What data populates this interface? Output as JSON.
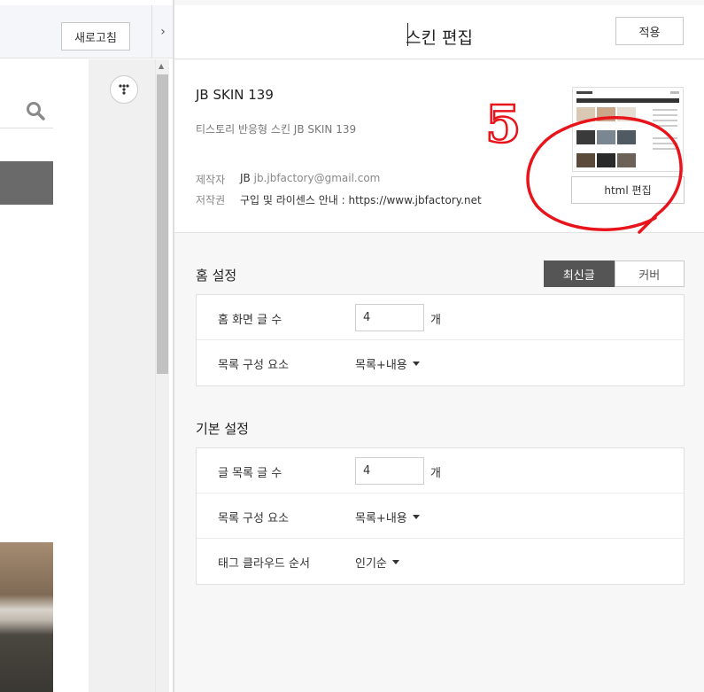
{
  "left": {
    "refresh_label": "새로고침",
    "collapse_glyph": "›"
  },
  "panel": {
    "title": "스킨 편집",
    "apply_label": "적용"
  },
  "skin": {
    "name": "JB SKIN 139",
    "description": "티스토리 반응형 스킨 JB SKIN 139",
    "maker_label": "제작자",
    "maker_name": "JB",
    "maker_email": "jb.jbfactory@gmail.com",
    "copyright_label": "저작권",
    "copyright_value": "구입 및 라이센스 안내 : https://www.jbfactory.net",
    "html_edit_label": "html 편집"
  },
  "home_settings": {
    "title": "홈 설정",
    "tabs": [
      {
        "label": "최신글",
        "active": true
      },
      {
        "label": "커버",
        "active": false
      }
    ],
    "rows": {
      "post_count_label": "홈 화면 글 수",
      "post_count_value": "4",
      "post_count_unit": "개",
      "list_elements_label": "목록 구성 요소",
      "list_elements_value": "목록+내용"
    }
  },
  "basic_settings": {
    "title": "기본 설정",
    "rows": {
      "post_count_label": "글 목록 글 수",
      "post_count_value": "4",
      "post_count_unit": "개",
      "list_elements_label": "목록 구성 요소",
      "list_elements_value": "목록+내용",
      "tag_order_label": "태그 클라우드 순서",
      "tag_order_value": "인기순"
    }
  },
  "annotation": {
    "number": "5",
    "color": "#e8141b"
  },
  "colors": {
    "active_tab": "#555555",
    "panel_bg": "#f7f7f7",
    "header_bg": "#f5f6f9"
  }
}
